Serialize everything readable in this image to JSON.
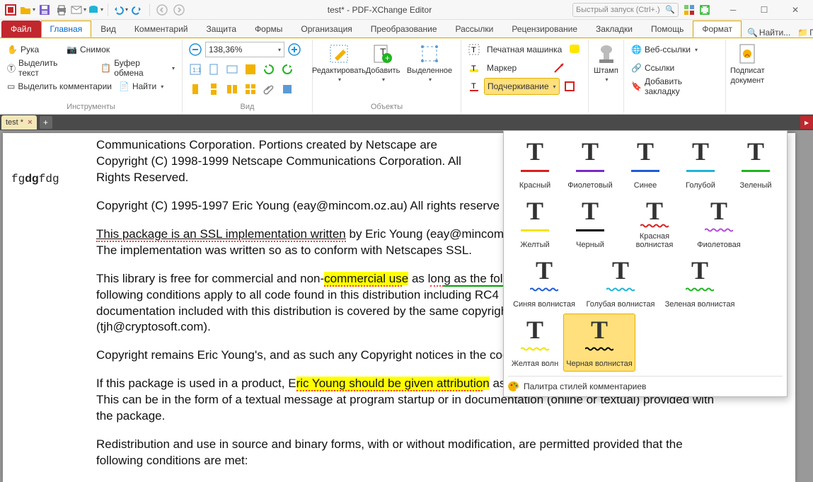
{
  "titlebar": {
    "title": "test* - PDF-XChange Editor",
    "quick_launch_placeholder": "Быстрый запуск (Ctrl+.)",
    "qat_icons": [
      "app-logo-icon",
      "open-icon",
      "save-icon",
      "print-icon",
      "email-icon",
      "scan-icon",
      "undo-icon",
      "redo-icon",
      "nav-back-icon",
      "nav-forward-icon"
    ]
  },
  "tabs": {
    "file": "Файл",
    "items": [
      "Главная",
      "Вид",
      "Комментарий",
      "Защита",
      "Формы",
      "Организация",
      "Преобразование",
      "Рассылки",
      "Рецензирование",
      "Закладки",
      "Помощь"
    ],
    "active_index": 0,
    "format": "Формат",
    "find": "Найти...",
    "search": "Поиск..."
  },
  "ribbon": {
    "tools": {
      "hand": "Рука",
      "snapshot": "Снимок",
      "select_text": "Выделить текст",
      "clipboard": "Буфер обмена",
      "select_comments": "Выделить комментарии",
      "find": "Найти",
      "group_label": "Инструменты"
    },
    "view": {
      "zoom_value": "138,36%",
      "group_label": "Вид"
    },
    "objects": {
      "edit": "Редактировать",
      "add": "Добавить",
      "selection": "Выделенное",
      "group_label": "Объекты"
    },
    "markup": {
      "typewriter": "Печатная машинка",
      "highlight": "Маркер",
      "underline": "Подчеркивание",
      "stamp": "Штамп"
    },
    "links": {
      "web_links": "Веб-ссылки",
      "links": "Ссылки",
      "add_bookmark": "Добавить закладку"
    },
    "sign": {
      "label_line1": "Подписат",
      "label_line2": "документ"
    }
  },
  "doc_tab": {
    "name": "test *"
  },
  "page_text": {
    "side_note": "fgdgfdg",
    "p1a": "Communications Corporation. Portions created by Netscape are",
    "p1b": "Copyright (C) 1998-1999 Netscape Communications Corporation. All",
    "p1c": "Rights Reserved.",
    "p2": "Copyright (C) 1995-1997 Eric Young (eay@mincom.oz.au) All rights reserve",
    "p3_underlined": "This package is an SSL implementation written",
    "p3_rest": " by Eric Young (eay@mincom",
    "p3b": "The implementation was written so as to conform with Netscapes SSL.",
    "p4a": "This library is free  for commercial and non-",
    "p4_hl": "commercial us",
    "p4_hl_e": "e",
    "p4_mid": " as l",
    "p4_ong": "on",
    "p4_gas": "g as the fol",
    "p4b": "following conditions apply to all code found in this distribution including RC4",
    "p4c": "documentation included with this distribution is covered by the same copyrigh",
    "p4d": "(tjh@cryptosoft.com).",
    "p5": "Copyright remains Eric Young's, and as such any Copyright notices in the cod",
    "p6a_pre": "If this package is used in a product, E",
    "p6a_hl": "ric Young should be given attributio",
    "p6a_n": "n",
    "p6a_post": " as",
    "p6b": "This can be in the form of a textual message at program startup or in documentation (online or textual) provided with",
    "p6c": "the package.",
    "p7a": "Redistribution and use in source and binary forms, with or without modification, are permitted provided that the",
    "p7b": "following conditions are met:"
  },
  "popup": {
    "items": [
      {
        "label": "Красный",
        "color": "#d8201f",
        "wavy": false
      },
      {
        "label": "Фиолетовый",
        "color": "#7a29c9",
        "wavy": false
      },
      {
        "label": "Синее",
        "color": "#1f5bd8",
        "wavy": false
      },
      {
        "label": "Голубой",
        "color": "#1fb4d8",
        "wavy": false
      },
      {
        "label": "Зеленый",
        "color": "#1fb41f",
        "wavy": false
      },
      {
        "label": "Желтый",
        "color": "#f2e500",
        "wavy": false
      },
      {
        "label": "Черный",
        "color": "#000000",
        "wavy": false
      },
      {
        "label": "Красная волнистая",
        "color": "#d8201f",
        "wavy": true,
        "wide": true
      },
      {
        "label": "Фиолетовая",
        "color": "#b24dd8",
        "wavy": true
      },
      {
        "label": "Синяя волнистая",
        "color": "#1f5bd8",
        "wavy": true,
        "wide": true
      },
      {
        "label": "Голубая волнистая",
        "color": "#1fb4d8",
        "wavy": true,
        "xwide": true
      },
      {
        "label": "Зеленая волнистая",
        "color": "#1fb41f",
        "wavy": true,
        "xwide": true
      },
      {
        "label": "Желтая волн",
        "color": "#f2e500",
        "wavy": true
      },
      {
        "label": "Черная волнистая",
        "color": "#000000",
        "wavy": true,
        "wide": true,
        "selected": true
      }
    ],
    "footer": "Палитра стилей комментариев"
  }
}
